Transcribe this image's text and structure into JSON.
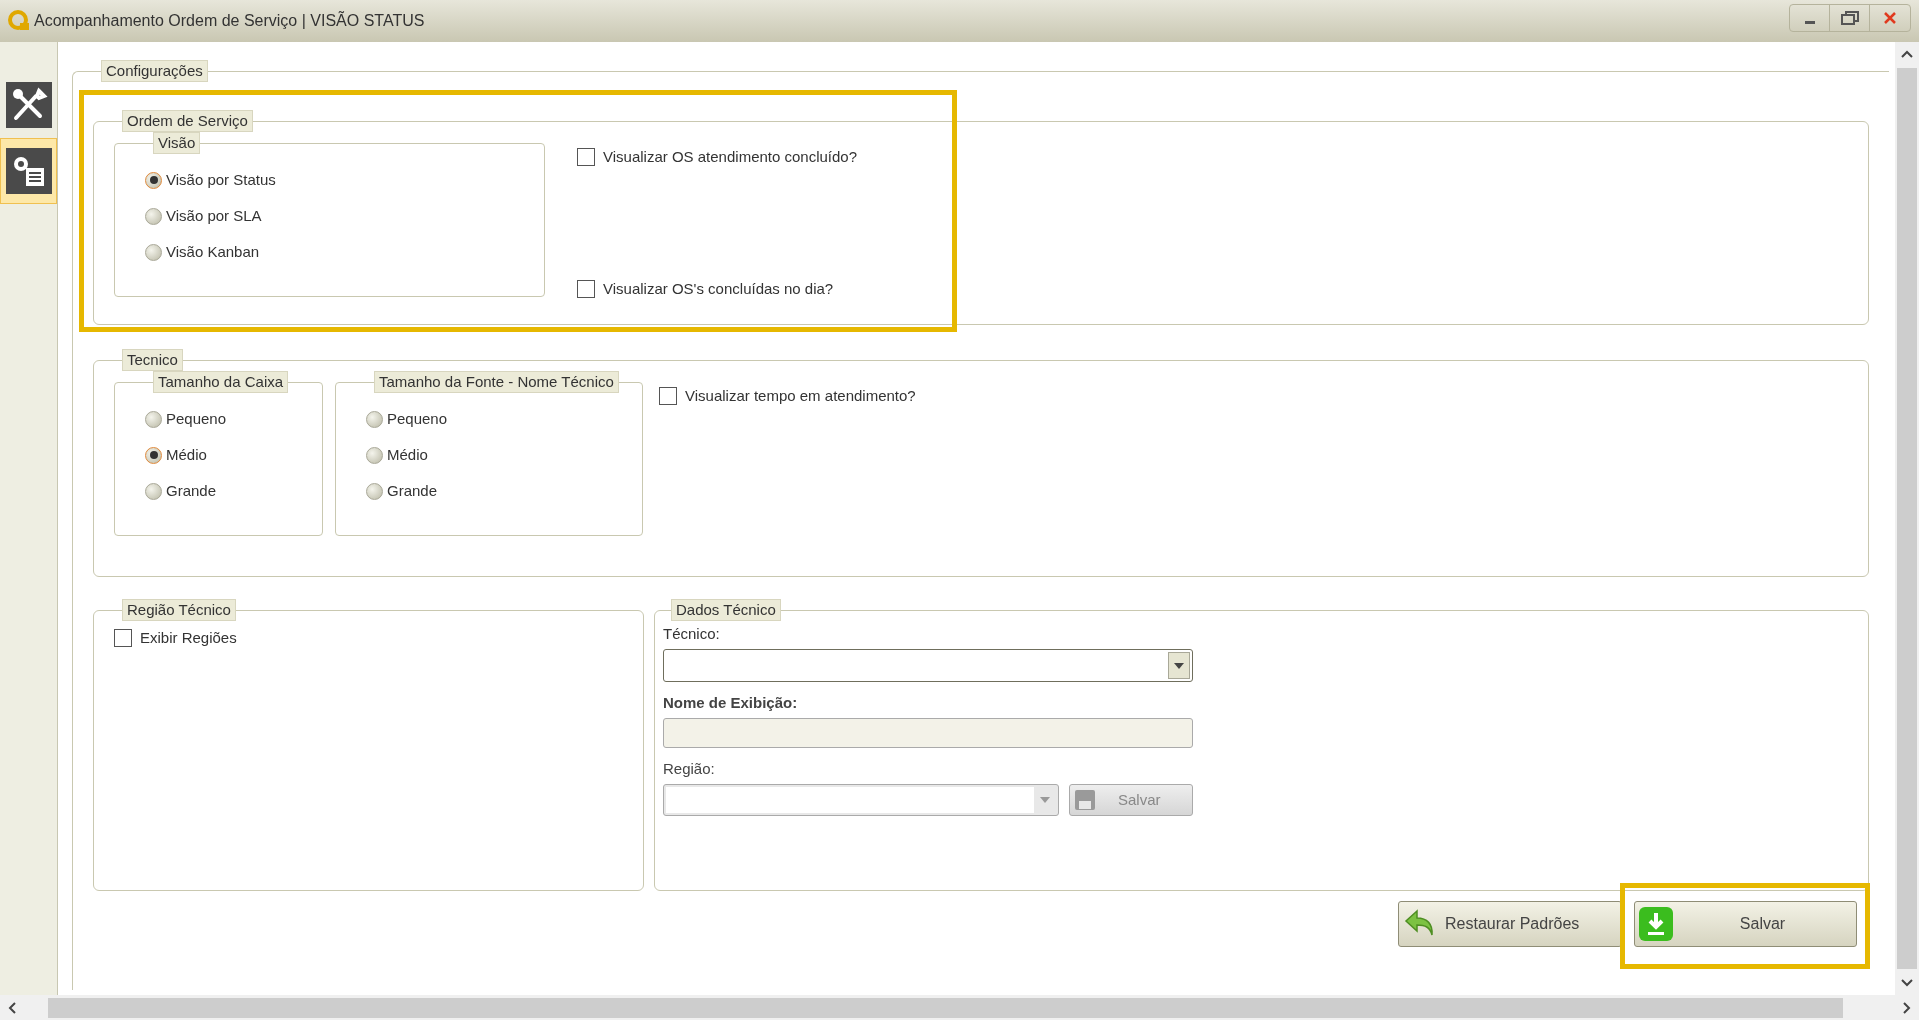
{
  "window": {
    "title": "Acompanhamento Ordem de Serviço | VISÃO STATUS"
  },
  "sidebar": {
    "items": [
      {
        "kind": "tools",
        "selected": false
      },
      {
        "kind": "settings",
        "selected": true
      }
    ]
  },
  "configuracoes": {
    "title": "Configurações",
    "ordem_de_servico": {
      "title": "Ordem de Serviço",
      "visao": {
        "title": "Visão",
        "options": [
          {
            "label": "Visão por Status",
            "selected": true
          },
          {
            "label": "Visão por SLA",
            "selected": false
          },
          {
            "label": "Visão Kanban",
            "selected": false
          }
        ]
      },
      "checkboxes": [
        {
          "label": "Visualizar OS atendimento concluído?",
          "checked": false
        },
        {
          "label": "Visualizar OS's concluídas no dia?",
          "checked": false
        }
      ]
    },
    "tecnico": {
      "title": "Tecnico",
      "tamanho_caixa": {
        "title": "Tamanho da Caixa",
        "options": [
          {
            "label": "Pequeno",
            "selected": false
          },
          {
            "label": "Médio",
            "selected": true
          },
          {
            "label": "Grande",
            "selected": false
          }
        ]
      },
      "tamanho_fonte": {
        "title": "Tamanho da Fonte - Nome Técnico",
        "options": [
          {
            "label": "Pequeno",
            "selected": false
          },
          {
            "label": "Médio",
            "selected": false
          },
          {
            "label": "Grande",
            "selected": false
          }
        ]
      },
      "checkbox": {
        "label": "Visualizar tempo em atendimento?",
        "checked": false
      }
    },
    "regiao_tecnico": {
      "title": "Região Técnico",
      "checkbox": {
        "label": "Exibir Regiões",
        "checked": false
      }
    },
    "dados_tecnico": {
      "title": "Dados Técnico",
      "tecnico_label": "Técnico:",
      "nome_label": "Nome de Exibição:",
      "regiao_label": "Região:",
      "save_button": {
        "label": "Salvar",
        "disabled": true
      }
    }
  },
  "buttons": [
    {
      "kind": "restore",
      "label": "Restaurar Padrões"
    },
    {
      "kind": "save",
      "label": "Salvar"
    }
  ]
}
